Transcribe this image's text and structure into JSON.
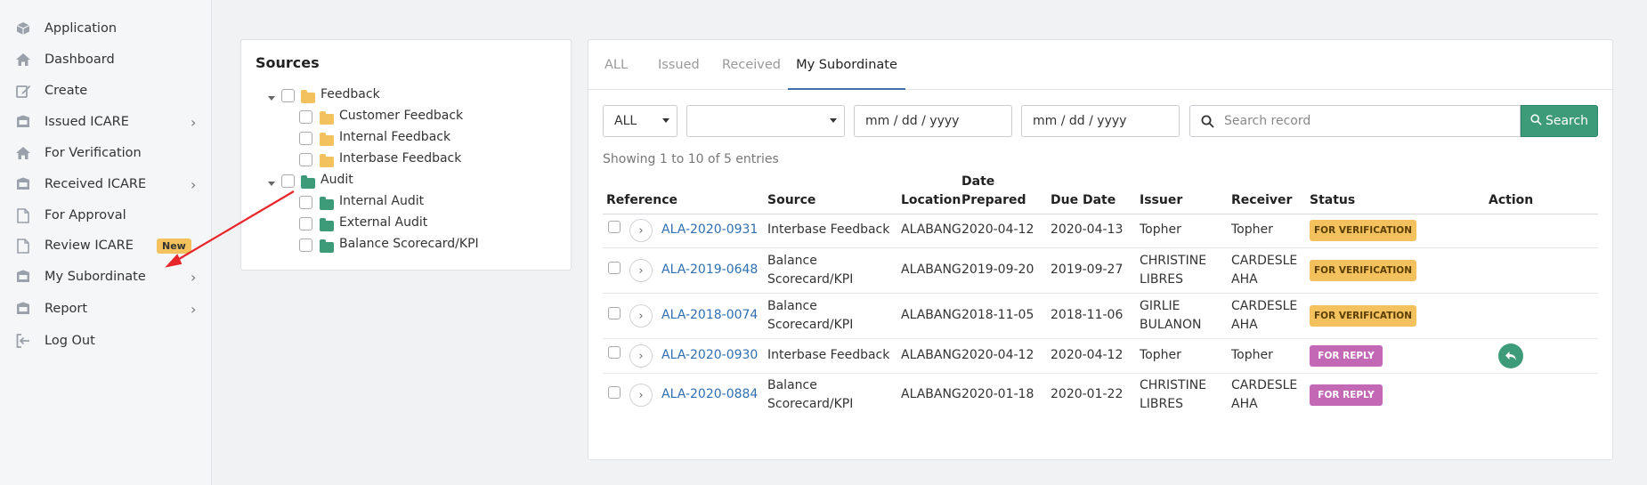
{
  "sidebar": {
    "items": [
      {
        "label": "Application",
        "icon": "cube-icon"
      },
      {
        "label": "Dashboard",
        "icon": "home-icon"
      },
      {
        "label": "Create",
        "icon": "edit-icon"
      },
      {
        "label": "Issued ICARE",
        "icon": "inbox-icon"
      },
      {
        "label": "For Verification",
        "icon": "home-icon"
      },
      {
        "label": "Received ICARE",
        "icon": "inbox-icon"
      },
      {
        "label": "For Approval",
        "icon": "file-icon"
      },
      {
        "label": "Review ICARE",
        "icon": "file-icon",
        "badge": "New"
      },
      {
        "label": "My Subordinate",
        "icon": "inbox-icon"
      },
      {
        "label": "Report",
        "icon": "inbox-icon"
      },
      {
        "label": "Log Out",
        "icon": "logout-icon"
      }
    ]
  },
  "sources": {
    "title": "Sources",
    "groups": [
      {
        "label": "Feedback",
        "children": [
          "Customer Feedback",
          "Internal Feedback",
          "Interbase Feedback"
        ]
      },
      {
        "label": "Audit",
        "children": [
          "Internal Audit",
          "External Audit",
          "Balance Scorecard/KPI"
        ]
      }
    ]
  },
  "tabs": [
    "ALL",
    "Issued",
    "Received",
    "My Subordinate"
  ],
  "filters": {
    "type_value": "ALL",
    "category_value": "",
    "date_from_placeholder": "mm / dd / yyyy",
    "date_to_placeholder": "mm / dd / yyyy",
    "search_placeholder": "Search record",
    "search_label": "Search"
  },
  "showing": "Showing 1 to 10 of 5 entries",
  "table": {
    "headers": [
      "Reference",
      "Source",
      "Location",
      "Date Prepared",
      "Due Date",
      "Issuer",
      "Receiver",
      "Status",
      "Action"
    ],
    "rows": [
      {
        "ref": "ALA-2020-0931",
        "source": "Interbase Feedback",
        "location": "ALABANG",
        "date_prepared": "2020-04-12",
        "due_date": "2020-04-13",
        "issuer": "Topher",
        "receiver": "Topher",
        "status": "FOR VERIFICATION"
      },
      {
        "ref": "ALA-2019-0648",
        "source": "Balance Scorecard/KPI",
        "location": "ALABANG",
        "date_prepared": "2019-09-20",
        "due_date": "2019-09-27",
        "issuer": "CHRISTINE LIBRES",
        "receiver": "CARDESLE AHA",
        "status": "FOR VERIFICATION"
      },
      {
        "ref": "ALA-2018-0074",
        "source": "Balance Scorecard/KPI",
        "location": "ALABANG",
        "date_prepared": "2018-11-05",
        "due_date": "2018-11-06",
        "issuer": "GIRLIE BULANON",
        "receiver": "CARDESLE AHA",
        "status": "FOR VERIFICATION"
      },
      {
        "ref": "ALA-2020-0930",
        "source": "Interbase Feedback",
        "location": "ALABANG",
        "date_prepared": "2020-04-12",
        "due_date": "2020-04-12",
        "issuer": "Topher",
        "receiver": "Topher",
        "status": "FOR REPLY"
      },
      {
        "ref": "ALA-2020-0884",
        "source": "Balance Scorecard/KPI",
        "location": "ALABANG",
        "date_prepared": "2020-01-18",
        "due_date": "2020-01-22",
        "issuer": "CHRISTINE LIBRES",
        "receiver": "CARDESLE AHA",
        "status": "FOR REPLY"
      }
    ]
  },
  "colors": {
    "accent": "#3f6ea8",
    "search_button": "#3d9b7a",
    "status_verification": "#f3c15d",
    "status_reply": "#c268b4",
    "annotation_arrow": "#e8262a"
  }
}
